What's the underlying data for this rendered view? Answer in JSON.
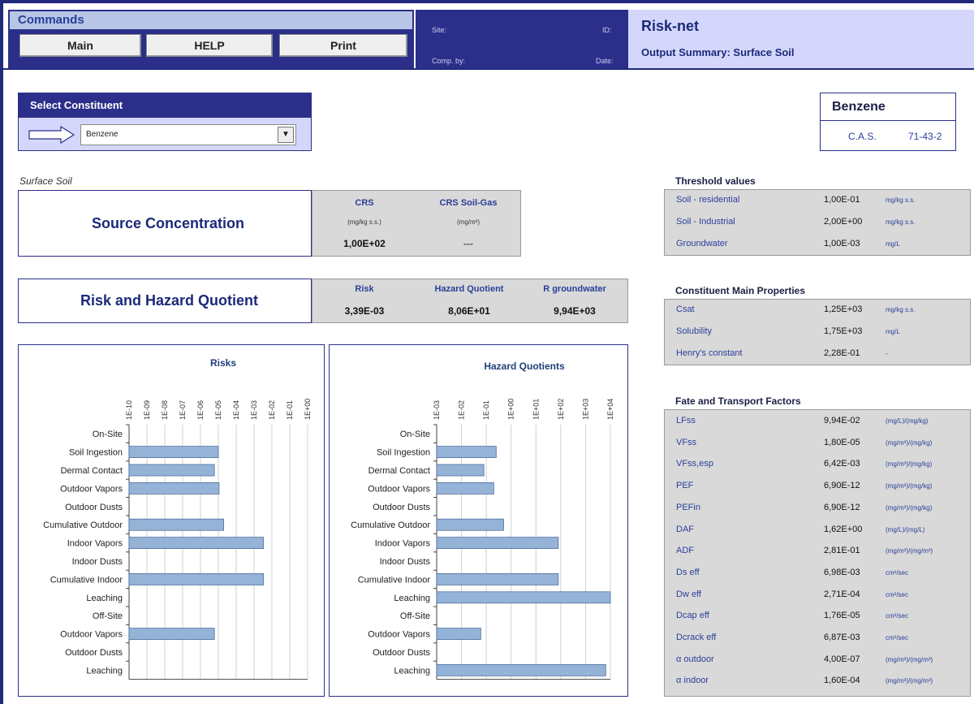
{
  "commands": {
    "title": "Commands",
    "buttons": [
      "Main",
      "HELP",
      "Print"
    ]
  },
  "site_info": {
    "site": "Site:",
    "id": "ID:",
    "comp_by": "Comp. by:",
    "date": "Date:"
  },
  "app": {
    "title": "Risk-net",
    "subtitle": "Output Summary: Surface Soil"
  },
  "select": {
    "title": "Select Constituent",
    "value": "Benzene"
  },
  "constituent": {
    "name": "Benzene",
    "cas_label": "C.A.S.",
    "cas_number": "71-43-2"
  },
  "section_label": "Surface Soil",
  "source": {
    "label": "Source Concentration",
    "columns": [
      {
        "header": "CRS",
        "unit": "(mg/kg s.s.)",
        "value": "1,00E+02"
      },
      {
        "header": "CRS Soil-Gas",
        "unit": "(mg/m³)",
        "value": "---"
      }
    ]
  },
  "risk": {
    "label": "Risk and Hazard Quotient",
    "columns": [
      {
        "header": "Risk",
        "value": "3,39E-03"
      },
      {
        "header": "Hazard Quotient",
        "value": "8,06E+01"
      },
      {
        "header": "R groundwater",
        "value": "9,94E+03"
      }
    ]
  },
  "threshold": {
    "title": "Threshold values",
    "rows": [
      {
        "name": "Soil - residential",
        "value": "1,00E-01",
        "unit": "mg/kg s.s."
      },
      {
        "name": "Soil - Industrial",
        "value": "2,00E+00",
        "unit": "mg/kg s.s."
      },
      {
        "name": "Groundwater",
        "value": "1,00E-03",
        "unit": "mg/L"
      }
    ]
  },
  "properties": {
    "title": "Constituent Main Properties",
    "rows": [
      {
        "name": "Csat",
        "value": "1,25E+03",
        "unit": "mg/kg s.s."
      },
      {
        "name": "Solubility",
        "value": "1,75E+03",
        "unit": "mg/L"
      },
      {
        "name": "Henry's constant",
        "value": "2,28E-01",
        "unit": "-"
      }
    ]
  },
  "fate": {
    "title": "Fate and Transport Factors",
    "rows": [
      {
        "name": "LFss",
        "value": "9,94E-02",
        "unit": "(mg/L)/(mg/kg)"
      },
      {
        "name": "VFss",
        "value": "1,80E-05",
        "unit": "(mg/m³)/(mg/kg)"
      },
      {
        "name": "VFss,esp",
        "value": "6,42E-03",
        "unit": "(mg/m³)/(mg/kg)"
      },
      {
        "name": "PEF",
        "value": "6,90E-12",
        "unit": "(mg/m³)/(mg/kg)"
      },
      {
        "name": "PEFin",
        "value": "6,90E-12",
        "unit": "(mg/m³)/(mg/kg)"
      },
      {
        "name": "DAF",
        "value": "1,62E+00",
        "unit": "(mg/L)/(mg/L)"
      },
      {
        "name": "ADF",
        "value": "2,81E-01",
        "unit": "(mg/m³)/(mg/m³)"
      },
      {
        "name": "Ds eff",
        "value": "6,98E-03",
        "unit": "cm²/sec"
      },
      {
        "name": "Dw eff",
        "value": "2,71E-04",
        "unit": "cm²/sec"
      },
      {
        "name": "Dcap eff",
        "value": "1,76E-05",
        "unit": "cm²/sec"
      },
      {
        "name": "Dcrack eff",
        "value": "6,87E-03",
        "unit": "cm²/sec"
      },
      {
        "name": "α outdoor",
        "value": "4,00E-07",
        "unit": "(mg/m³)/(mg/m³)"
      },
      {
        "name": "α indoor",
        "value": "1,60E-04",
        "unit": "(mg/m³)/(mg/m³)"
      }
    ]
  },
  "chart_data": [
    {
      "type": "bar",
      "title": "Risks",
      "orientation": "horizontal",
      "scale": "log",
      "xlim": [
        -10,
        0
      ],
      "tick_labels": [
        "1E-10",
        "1E-09",
        "1E-08",
        "1E-07",
        "1E-06",
        "1E-05",
        "1E-04",
        "1E-03",
        "1E-02",
        "1E-01",
        "1E+00"
      ],
      "categories": [
        "On-Site",
        "Soil Ingestion",
        "Dermal Contact",
        "Outdoor Vapors",
        "Outdoor Dusts",
        "Cumulative Outdoor",
        "Indoor Vapors",
        "Indoor Dusts",
        "Cumulative Indoor",
        "Leaching",
        "Off-Site",
        "Outdoor Vapors",
        "Outdoor Dusts",
        "Leaching"
      ],
      "values": [
        null,
        1e-05,
        6e-06,
        1.1e-05,
        null,
        2e-05,
        0.0034,
        null,
        0.0034,
        null,
        null,
        6e-06,
        null,
        null
      ],
      "bar_color": "#95b3d7",
      "grid": true
    },
    {
      "type": "bar",
      "title": "Hazard Quotients",
      "orientation": "horizontal",
      "scale": "log",
      "xlim": [
        -3,
        4
      ],
      "tick_labels": [
        "1E-03",
        "1E-02",
        "1E-01",
        "1E+00",
        "1E+01",
        "1E+02",
        "1E+03",
        "1E+04"
      ],
      "categories": [
        "On-Site",
        "Soil Ingestion",
        "Dermal Contact",
        "Outdoor Vapors",
        "Outdoor Dusts",
        "Cumulative Outdoor",
        "Indoor Vapors",
        "Indoor Dusts",
        "Cumulative Indoor",
        "Leaching",
        "Off-Site",
        "Outdoor Vapors",
        "Outdoor Dusts",
        "Leaching"
      ],
      "values": [
        null,
        0.25,
        0.08,
        0.2,
        null,
        0.5,
        80,
        null,
        80,
        10000,
        null,
        0.06,
        null,
        6500
      ],
      "bar_color": "#95b3d7",
      "grid": true
    }
  ]
}
